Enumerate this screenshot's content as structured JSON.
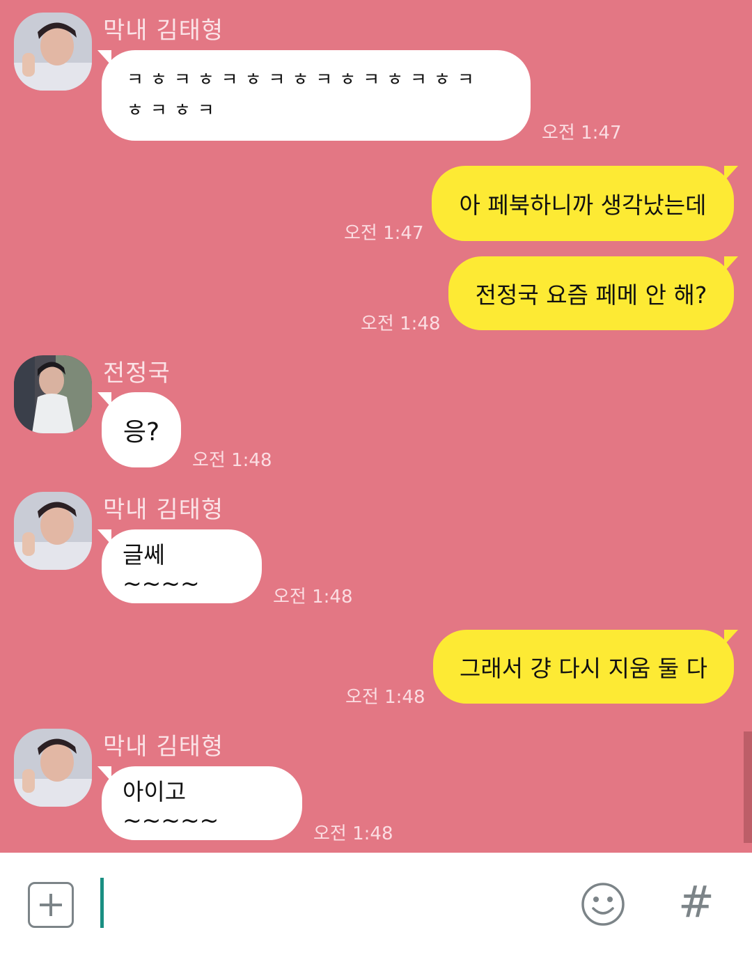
{
  "colors": {
    "chat_background": "#e37784",
    "incoming_bubble": "#ffffff",
    "outgoing_bubble": "#fdea34",
    "input_cursor": "#1a8f82"
  },
  "messages": [
    {
      "direction": "incoming",
      "sender": "막내 김태형",
      "avatar_icon": "profile-photo-icon",
      "text": "ㅋㅎㅋㅎㅋㅎㅋㅎㅋㅎㅋㅎㅋㅎㅋ",
      "text2": "ㅎㅋㅎㅋ",
      "time": "오전 1:47"
    },
    {
      "direction": "outgoing",
      "text": "아 페북하니까 생각났는데",
      "time": "오전 1:47"
    },
    {
      "direction": "outgoing",
      "text": "전정국 요즘 페메 안 해?",
      "time": "오전 1:48"
    },
    {
      "direction": "incoming",
      "sender": "전정국",
      "avatar_icon": "profile-photo-icon",
      "text": "응?",
      "time": "오전 1:48"
    },
    {
      "direction": "incoming",
      "sender": "막내 김태형",
      "avatar_icon": "profile-photo-icon",
      "text": "글쎄~~~~",
      "time": "오전 1:48"
    },
    {
      "direction": "outgoing",
      "text": "그래서 걍 다시 지움 둘 다",
      "time": "오전 1:48"
    },
    {
      "direction": "incoming",
      "sender": "막내 김태형",
      "avatar_icon": "profile-photo-icon",
      "text": "아이고~~~~~",
      "time": "오전 1:48"
    }
  ],
  "input_bar": {
    "left_icon": "plus-square-icon",
    "emoji_icon": "smiley-icon",
    "hashtag_label": "#"
  }
}
